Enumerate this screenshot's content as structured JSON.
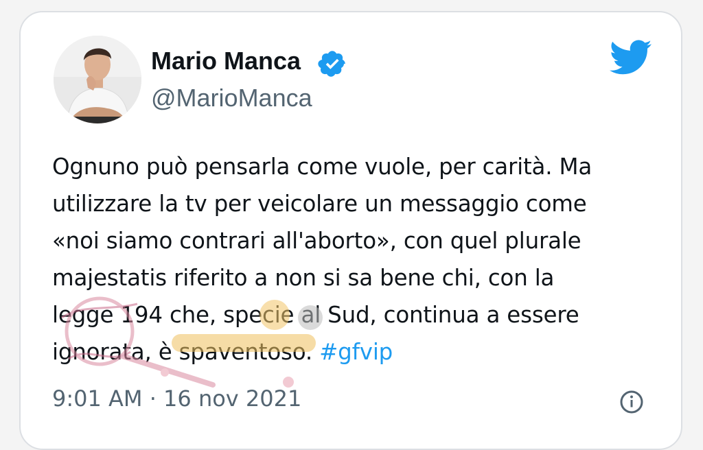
{
  "tweet": {
    "author_name": "Mario Manca",
    "author_handle": "@MarioManca",
    "lines": [
      "Ognuno può pensarla come vuole, per carità. Ma",
      "utilizzare la tv per veicolare un messaggio come",
      "«noi siamo contrari all'aborto», con quel plurale",
      "majestatis riferito a non si sa bene chi, con la",
      "legge 194 che, specie al Sud, continua a essere",
      "ignorata, è spaventoso. "
    ],
    "hashtag": "#gfvip",
    "timestamp": "9:01 AM · 16 nov 2021"
  },
  "icons": {
    "verified": "verified-badge-icon",
    "brand": "twitter-bird-icon",
    "info": "info-icon"
  },
  "colors": {
    "brand_blue": "#1d9bf0",
    "text": "#0f1419",
    "muted": "#536471"
  }
}
